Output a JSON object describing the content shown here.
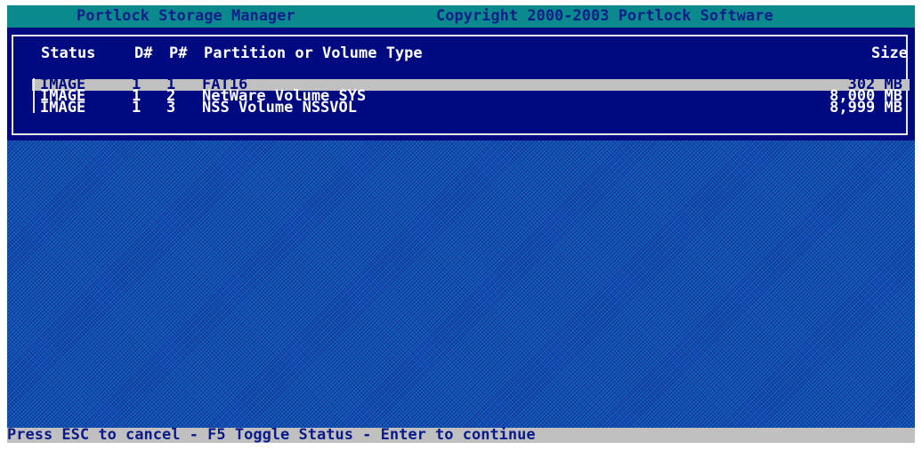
{
  "title_bar": {
    "app_name": "Portlock Storage Manager",
    "copyright": "Copyright 2000-2003 Portlock Software"
  },
  "table": {
    "headers": {
      "status": "Status",
      "disk": "D#",
      "partition": "P#",
      "type": "Partition or Volume Type",
      "size": "Size"
    },
    "rows": [
      {
        "status": "IMAGE",
        "disk": "1",
        "partition": "1",
        "type": "FAT16",
        "size": "302 MB",
        "selected": true
      },
      {
        "status": "IMAGE",
        "disk": "1",
        "partition": "2",
        "type": "NetWare Volume SYS",
        "size": "8,000 MB",
        "selected": false
      },
      {
        "status": "IMAGE",
        "disk": "1",
        "partition": "3",
        "type": "NSS Volume NSSVOL",
        "size": "8,999 MB",
        "selected": false
      }
    ]
  },
  "status_bar": {
    "text": "Press ESC to cancel - F5 Toggle Status - Enter to continue"
  },
  "colors": {
    "panel_background": "#000a80",
    "title_background": "#0a8a8c",
    "selection_background": "#c0c0c0",
    "desktop_pattern": "#1a44b0"
  }
}
